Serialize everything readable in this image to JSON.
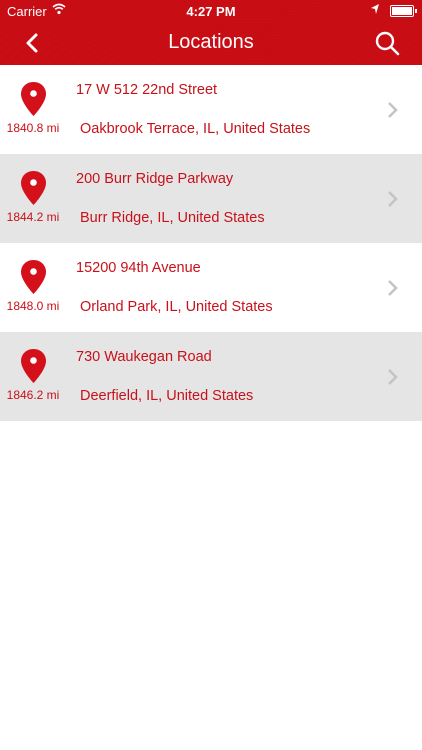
{
  "status_bar": {
    "carrier": "Carrier",
    "time": "4:27 PM"
  },
  "nav": {
    "title": "Locations",
    "back_icon": "chevron-left-icon",
    "search_icon": "search-icon"
  },
  "colors": {
    "brand": "#c8111a",
    "alt_row": "#e5e5e5",
    "chevron": "#c4c4c4"
  },
  "locations": [
    {
      "distance": "1840.8 mi",
      "street": "17 W 512 22nd Street",
      "city": "Oakbrook Terrace, IL, United States"
    },
    {
      "distance": "1844.2 mi",
      "street": "200 Burr Ridge Parkway",
      "city": "Burr Ridge, IL, United States"
    },
    {
      "distance": "1848.0 mi",
      "street": "15200 94th Avenue",
      "city": "Orland Park, IL, United States"
    },
    {
      "distance": "1846.2 mi",
      "street": "730 Waukegan Road",
      "city": "Deerfield, IL, United States"
    }
  ]
}
